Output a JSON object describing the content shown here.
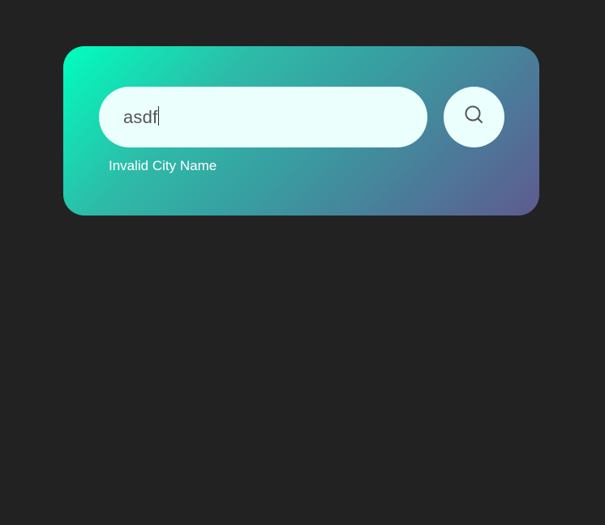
{
  "search": {
    "value": "asdf",
    "error_message": "Invalid City Name"
  },
  "icons": {
    "search_button_icon": "search-icon"
  },
  "colors": {
    "background": "#222222",
    "card_gradient_start": "#00ffbf",
    "card_gradient_end": "#5e5a8e",
    "input_background": "#ebfffc",
    "input_text": "#555555",
    "error_text": "#ffffff"
  }
}
